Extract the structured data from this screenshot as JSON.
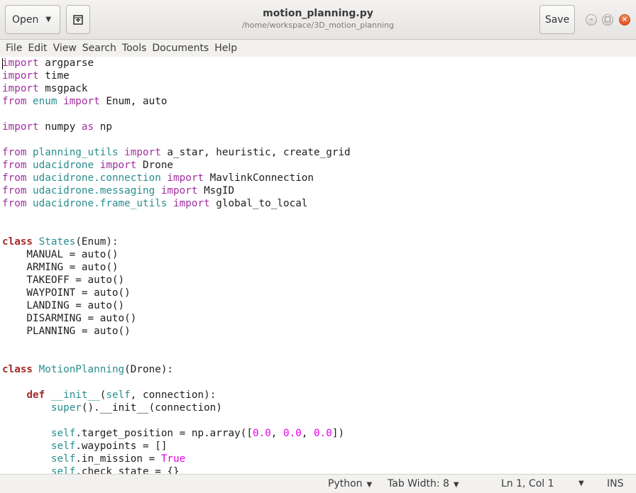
{
  "header": {
    "open_label": "Open",
    "save_label": "Save",
    "title": "motion_planning.py",
    "subtitle": "/home/workspace/3D_motion_planning"
  },
  "menu": [
    "File",
    "Edit",
    "View",
    "Search",
    "Tools",
    "Documents",
    "Help"
  ],
  "status": {
    "language": "Python",
    "tab_width": "Tab Width: 8",
    "position": "Ln 1, Col 1",
    "mode": "INS"
  },
  "code_lines": [
    [
      [
        "kw",
        "import"
      ],
      [
        "t",
        " argparse"
      ]
    ],
    [
      [
        "kw",
        "import"
      ],
      [
        "t",
        " time"
      ]
    ],
    [
      [
        "kw",
        "import"
      ],
      [
        "t",
        " msgpack"
      ]
    ],
    [
      [
        "kw",
        "from"
      ],
      [
        "t",
        " "
      ],
      [
        "mod",
        "enum"
      ],
      [
        "t",
        " "
      ],
      [
        "kw",
        "import"
      ],
      [
        "t",
        " Enum, auto"
      ]
    ],
    [],
    [
      [
        "kw",
        "import"
      ],
      [
        "t",
        " numpy "
      ],
      [
        "kw",
        "as"
      ],
      [
        "t",
        " np"
      ]
    ],
    [],
    [
      [
        "kw",
        "from"
      ],
      [
        "t",
        " "
      ],
      [
        "mod",
        "planning_utils"
      ],
      [
        "t",
        " "
      ],
      [
        "kw",
        "import"
      ],
      [
        "t",
        " a_star, heuristic, create_grid"
      ]
    ],
    [
      [
        "kw",
        "from"
      ],
      [
        "t",
        " "
      ],
      [
        "mod",
        "udacidrone"
      ],
      [
        "t",
        " "
      ],
      [
        "kw",
        "import"
      ],
      [
        "t",
        " Drone"
      ]
    ],
    [
      [
        "kw",
        "from"
      ],
      [
        "t",
        " "
      ],
      [
        "mod",
        "udacidrone.connection"
      ],
      [
        "t",
        " "
      ],
      [
        "kw",
        "import"
      ],
      [
        "t",
        " MavlinkConnection"
      ]
    ],
    [
      [
        "kw",
        "from"
      ],
      [
        "t",
        " "
      ],
      [
        "mod",
        "udacidrone.messaging"
      ],
      [
        "t",
        " "
      ],
      [
        "kw",
        "import"
      ],
      [
        "t",
        " MsgID"
      ]
    ],
    [
      [
        "kw",
        "from"
      ],
      [
        "t",
        " "
      ],
      [
        "mod",
        "udacidrone.frame_utils"
      ],
      [
        "t",
        " "
      ],
      [
        "kw",
        "import"
      ],
      [
        "t",
        " global_to_local"
      ]
    ],
    [],
    [],
    [
      [
        "kw2",
        "class"
      ],
      [
        "t",
        " "
      ],
      [
        "mod",
        "States"
      ],
      [
        "t",
        "(Enum):"
      ]
    ],
    [
      [
        "t",
        "    MANUAL = auto()"
      ]
    ],
    [
      [
        "t",
        "    ARMING = auto()"
      ]
    ],
    [
      [
        "t",
        "    TAKEOFF = auto()"
      ]
    ],
    [
      [
        "t",
        "    WAYPOINT = auto()"
      ]
    ],
    [
      [
        "t",
        "    LANDING = auto()"
      ]
    ],
    [
      [
        "t",
        "    DISARMING = auto()"
      ]
    ],
    [
      [
        "t",
        "    PLANNING = auto()"
      ]
    ],
    [],
    [],
    [
      [
        "kw2",
        "class"
      ],
      [
        "t",
        " "
      ],
      [
        "mod",
        "MotionPlanning"
      ],
      [
        "t",
        "(Drone):"
      ]
    ],
    [],
    [
      [
        "t",
        "    "
      ],
      [
        "kw2",
        "def"
      ],
      [
        "t",
        " "
      ],
      [
        "mod",
        "__init__"
      ],
      [
        "t",
        "("
      ],
      [
        "mod",
        "self"
      ],
      [
        "t",
        ", connection):"
      ]
    ],
    [
      [
        "t",
        "        "
      ],
      [
        "mod",
        "super"
      ],
      [
        "t",
        "().__init__(connection)"
      ]
    ],
    [],
    [
      [
        "t",
        "        "
      ],
      [
        "mod",
        "self"
      ],
      [
        "t",
        ".target_position = np.array(["
      ],
      [
        "num",
        "0.0"
      ],
      [
        "t",
        ", "
      ],
      [
        "num",
        "0.0"
      ],
      [
        "t",
        ", "
      ],
      [
        "num",
        "0.0"
      ],
      [
        "t",
        "])"
      ]
    ],
    [
      [
        "t",
        "        "
      ],
      [
        "mod",
        "self"
      ],
      [
        "t",
        ".waypoints = []"
      ]
    ],
    [
      [
        "t",
        "        "
      ],
      [
        "mod",
        "self"
      ],
      [
        "t",
        ".in_mission = "
      ],
      [
        "num",
        "True"
      ]
    ],
    [
      [
        "t",
        "        "
      ],
      [
        "mod",
        "self"
      ],
      [
        "t",
        ".check_state = {}"
      ]
    ]
  ]
}
